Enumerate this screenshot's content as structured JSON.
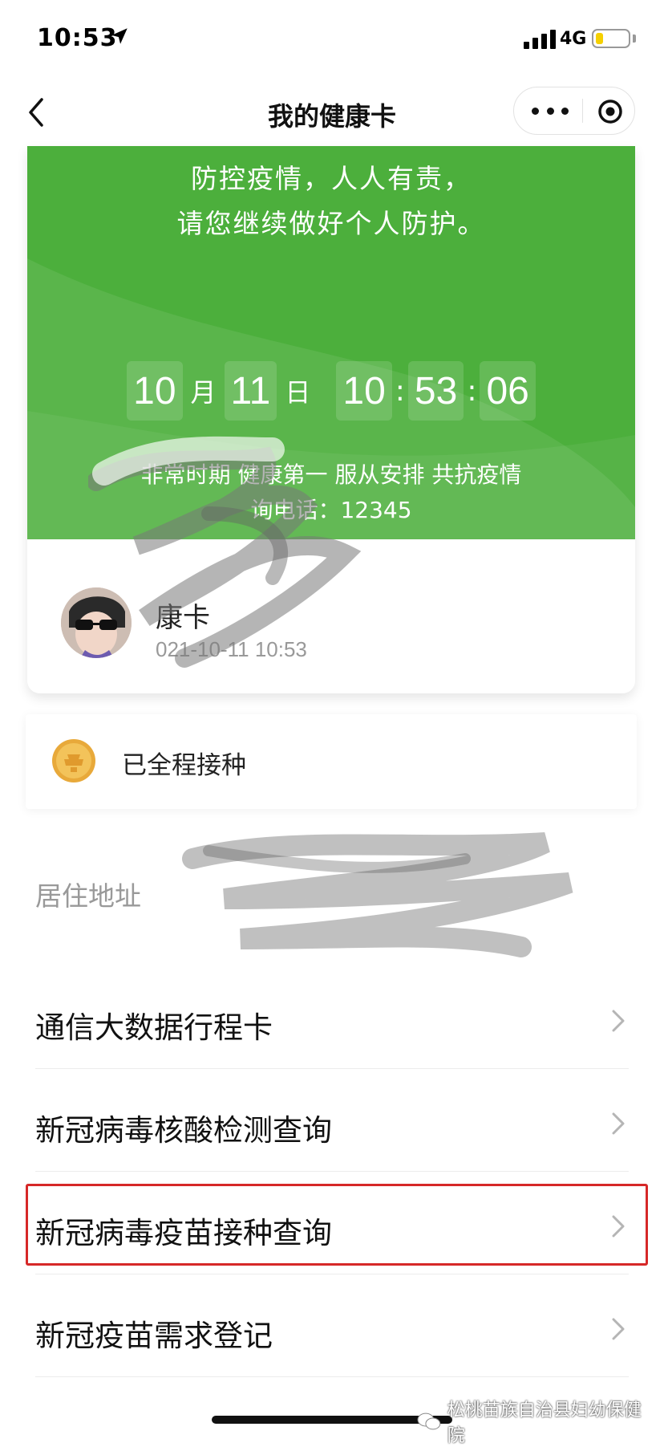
{
  "status_bar": {
    "time": "10:53",
    "network": "4G",
    "battery_level": 0.22,
    "battery_color": "#f5d000"
  },
  "nav": {
    "title": "我的健康卡",
    "back_icon": "chevron-left-icon",
    "more_icon": "more-dots-icon",
    "close_icon": "record-close-icon"
  },
  "card": {
    "color": "#4caf3c",
    "slogan_line1": "防控疫情，人人有责，",
    "slogan_line2": "请您继续做好个人防护。",
    "clock": {
      "month": "10",
      "month_unit": "月",
      "day": "11",
      "day_unit": "日",
      "hour": "10",
      "minute": "53",
      "second": "06",
      "separator": ":"
    },
    "motto": "非常时期 健康第一 服从安排 共抗疫情",
    "hotline": "询电话：12345",
    "card_name": "康卡",
    "issued_time": "021-10-11 10:53"
  },
  "vaccine": {
    "status": "已全程接种",
    "badge_icon": "gold-badge-icon"
  },
  "address": {
    "label": "居住地址"
  },
  "menu": [
    {
      "label": "通信大数据行程卡"
    },
    {
      "label": "新冠病毒核酸检测查询"
    },
    {
      "label": "新冠病毒疫苗接种查询",
      "highlighted": true
    },
    {
      "label": "新冠疫苗需求登记"
    }
  ],
  "watermark": "松桃苗族自治县妇幼保健院",
  "highlight_color": "#d62828"
}
